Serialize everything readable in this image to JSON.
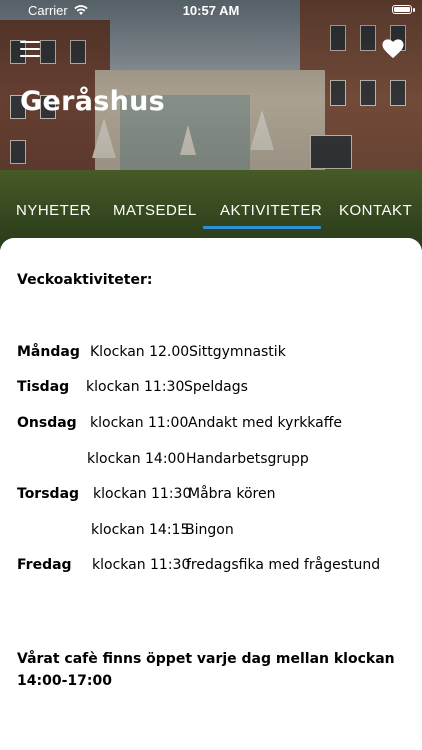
{
  "status_bar": {
    "carrier": "Carrier",
    "time": "10:57 AM"
  },
  "header": {
    "title": "Geråshus"
  },
  "tabs": [
    {
      "label": "NYHETER"
    },
    {
      "label": "MATSEDEL"
    },
    {
      "label": "AKTIVITETER",
      "active": true
    },
    {
      "label": "KONTAKT"
    }
  ],
  "content": {
    "heading": "Veckoaktiviteter:",
    "schedule": [
      {
        "day": "Måndag",
        "time": "Klockan 12.00",
        "activity": "Sittgymnastik"
      },
      {
        "day": "Tisdag",
        "time": "klockan 11:30",
        "activity": "Speldags"
      },
      {
        "day": "Onsdag",
        "time": "klockan 11:00",
        "activity": "Andakt med kyrkkaffe"
      },
      {
        "day": "",
        "time": "klockan 14:00",
        "activity": "Handarbetsgrupp"
      },
      {
        "day": "Torsdag",
        "time": "klockan 11:30",
        "activity": "Måbra kören"
      },
      {
        "day": "",
        "time": "klockan 14:15",
        "activity": "Bingon"
      },
      {
        "day": "Fredag",
        "time": "klockan 11:30",
        "activity": "fredagsfika med frågestund"
      }
    ],
    "cafe_note": "Vårat cafè finns öppet varje dag mellan klockan 14:00-17:00"
  },
  "colors": {
    "accent": "#2f8fd9",
    "text": "#000000",
    "header_text": "#ffffff"
  },
  "icons": {
    "menu": "hamburger-menu-icon",
    "favorite": "heart-icon",
    "wifi": "wifi-icon",
    "battery": "battery-icon"
  }
}
